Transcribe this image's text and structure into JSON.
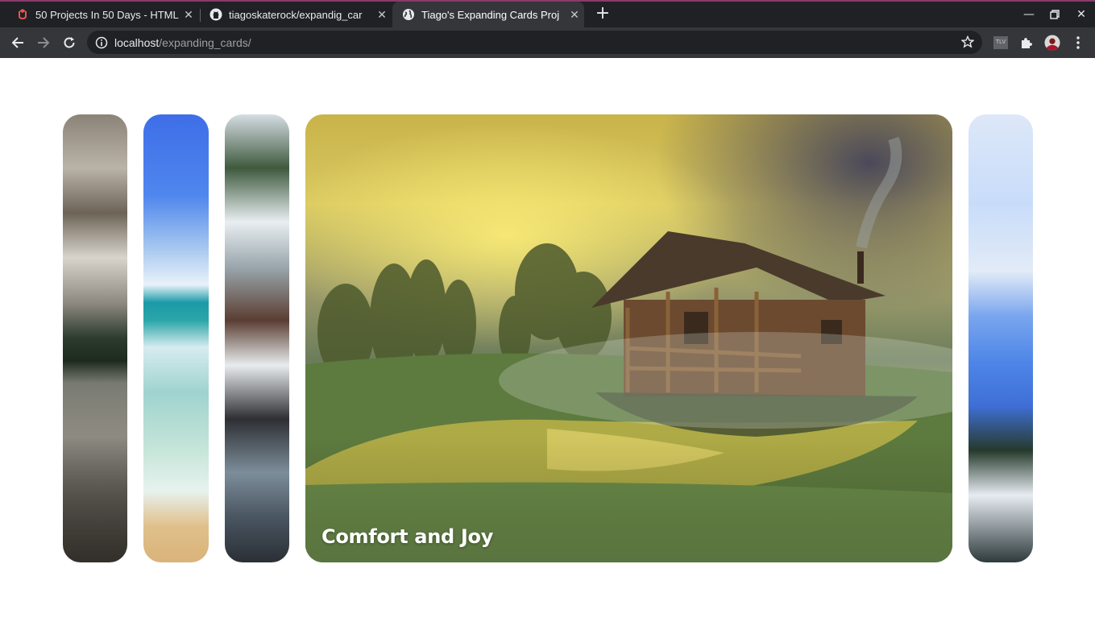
{
  "browser": {
    "tabs": [
      {
        "title": "50 Projects In 50 Days - HTML,",
        "active": false,
        "favicon": "udemy-icon"
      },
      {
        "title": "tiagoskaterock/expandig_car",
        "active": false,
        "favicon": "github-icon"
      },
      {
        "title": "Tiago's Expanding Cards Proj",
        "active": true,
        "favicon": "globe-icon"
      }
    ],
    "url": {
      "host": "localhost",
      "path": "/expanding_cards/"
    },
    "extension_label": "TLV"
  },
  "page": {
    "panels": [
      {
        "title": "",
        "active": false
      },
      {
        "title": "",
        "active": false
      },
      {
        "title": "",
        "active": false
      },
      {
        "title": "Comfort and Joy",
        "active": true
      },
      {
        "title": "",
        "active": false
      }
    ]
  },
  "colors": {
    "tabbar_bg": "#202124",
    "toolbar_bg": "#35363a",
    "accent_border": "#8a3a6a"
  }
}
